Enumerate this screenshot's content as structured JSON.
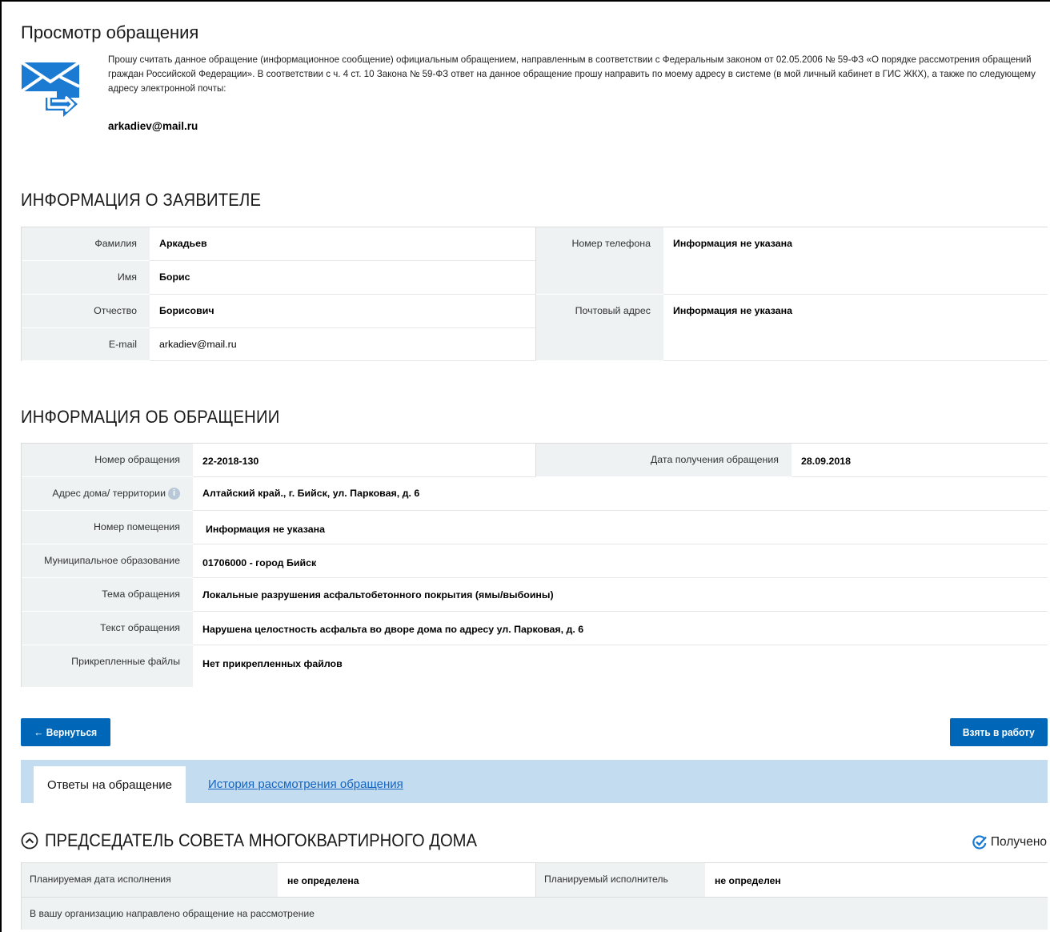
{
  "page": {
    "title": "Просмотр обращения",
    "intro_text": "Прошу считать данное обращение (информационное сообщение) официальным обращением, направленным в соответствии с Федеральным законом от 02.05.2006 № 59-ФЗ «О порядке рассмотрения обращений граждан Российской Федерации». В соответствии с ч. 4 ст. 10 Закона № 59-ФЗ ответ на данное обращение прошу направить по моему адресу в системе (в мой личный кабинет в ГИС ЖКХ), а также по следующему адресу электронной почты:",
    "intro_email": "arkadiev@mail.ru"
  },
  "applicant": {
    "heading": "ИНФОРМАЦИЯ О ЗАЯВИТЕЛЕ",
    "surname_label": "Фамилия",
    "surname": "Аркадьев",
    "name_label": "Имя",
    "name": "Борис",
    "patronymic_label": "Отчество",
    "patronymic": "Борисович",
    "email_label": "E-mail",
    "email": "arkadiev@mail.ru",
    "phone_label": "Номер телефона",
    "phone": "Информация не указана",
    "postal_label": "Почтовый адрес",
    "postal": "Информация не указана"
  },
  "appeal": {
    "heading": "ИНФОРМАЦИЯ ОБ ОБРАЩЕНИИ",
    "number_label": "Номер обращения",
    "number": "22-2018-130",
    "date_label": "Дата получения обращения",
    "date": "28.09.2018",
    "address_label": "Адрес дома/ территории",
    "address": "Алтайский край., г. Бийск, ул. Парковая, д. 6",
    "room_label": "Номер помещения",
    "room": "Информация не указана",
    "municipality_label": "Муниципальное образование",
    "municipality": "01706000 - город Бийск",
    "topic_label": "Тема обращения",
    "topic": "Локальные разрушения асфальтобетонного покрытия (ямы/выбоины)",
    "text_label": "Текст обращения",
    "text": "Нарушена целостность асфальта во дворе дома по адресу ул. Парковая, д. 6",
    "files_label": "Прикрепленные файлы",
    "files": "Нет прикрепленных файлов"
  },
  "actions": {
    "back": "← Вернуться",
    "take": "Взять в работу"
  },
  "tabs": {
    "answers": "Ответы на обращение",
    "history": "История рассмотрения обращения"
  },
  "answer": {
    "title": "ПРЕДСЕДАТЕЛЬ СОВЕТА МНОГОКВАРТИРНОГО ДОМА",
    "status": "Получено",
    "planned_date_label": "Планируемая дата исполнения",
    "planned_date": "не определена",
    "planned_executor_label": "Планируемый исполнитель",
    "planned_executor": "не определен",
    "note": "В вашу организацию направлено обращение на рассмотрение"
  },
  "colors": {
    "accent": "#0066b8",
    "tabs_bg": "#c3dcef",
    "label_bg": "#eef2f2",
    "link": "#1565c0",
    "icon": "#1b7ad1"
  }
}
